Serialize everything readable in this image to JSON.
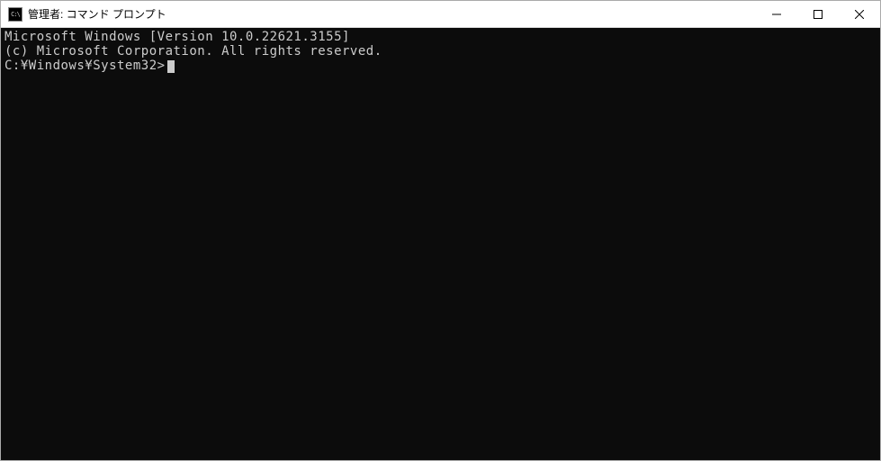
{
  "titlebar": {
    "icon_label": "C:\\",
    "title": "管理者: コマンド プロンプト",
    "minimize_label": "Minimize",
    "maximize_label": "Maximize",
    "close_label": "Close"
  },
  "console": {
    "line1": "Microsoft Windows [Version 10.0.22621.3155]",
    "line2": "(c) Microsoft Corporation. All rights reserved.",
    "blank": "",
    "prompt": "C:¥Windows¥System32>"
  }
}
